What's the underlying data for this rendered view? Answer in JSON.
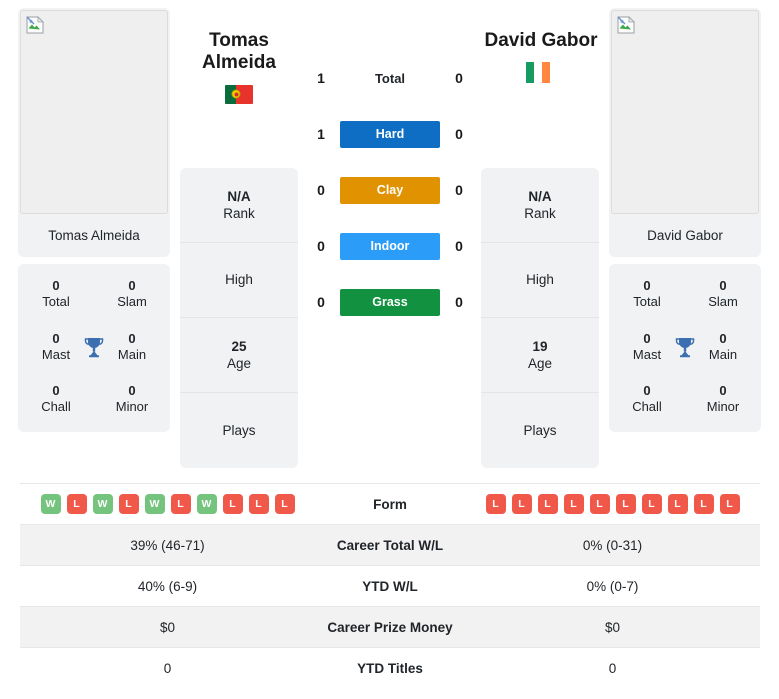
{
  "players": {
    "left": {
      "name": "Tomas Almeida",
      "display_name_line1": "Tomas",
      "display_name_line2": "Almeida",
      "country": "Portugal",
      "flag_icon": "flag-portugal-icon",
      "photo_placeholder": "broken-image-icon",
      "titles": {
        "total_value": "0",
        "total_label": "Total",
        "slam_value": "0",
        "slam_label": "Slam",
        "mast_value": "0",
        "mast_label": "Mast",
        "main_value": "0",
        "main_label": "Main",
        "chall_value": "0",
        "chall_label": "Chall",
        "minor_value": "0",
        "minor_label": "Minor",
        "trophy_icon": "trophy-icon"
      },
      "info": {
        "rank_value": "N/A",
        "rank_label": "Rank",
        "high_value": "",
        "high_label": "High",
        "age_value": "25",
        "age_label": "Age",
        "plays_value": "",
        "plays_label": "Plays"
      },
      "form": [
        "W",
        "L",
        "W",
        "L",
        "W",
        "L",
        "W",
        "L",
        "L",
        "L"
      ],
      "career_total_wl": "39% (46-71)",
      "ytd_wl": "40% (6-9)",
      "career_prize_money": "$0",
      "ytd_titles": "0"
    },
    "right": {
      "name": "David Gabor",
      "display_name_line1": "David Gabor",
      "display_name_line2": "",
      "country": "Ireland",
      "flag_icon": "flag-ireland-icon",
      "photo_placeholder": "broken-image-icon",
      "titles": {
        "total_value": "0",
        "total_label": "Total",
        "slam_value": "0",
        "slam_label": "Slam",
        "mast_value": "0",
        "mast_label": "Mast",
        "main_value": "0",
        "main_label": "Main",
        "chall_value": "0",
        "chall_label": "Chall",
        "minor_value": "0",
        "minor_label": "Minor",
        "trophy_icon": "trophy-icon"
      },
      "info": {
        "rank_value": "N/A",
        "rank_label": "Rank",
        "high_value": "",
        "high_label": "High",
        "age_value": "19",
        "age_label": "Age",
        "plays_value": "",
        "plays_label": "Plays"
      },
      "form": [
        "L",
        "L",
        "L",
        "L",
        "L",
        "L",
        "L",
        "L",
        "L",
        "L"
      ],
      "career_total_wl": "0% (0-31)",
      "ytd_wl": "0% (0-7)",
      "career_prize_money": "$0",
      "ytd_titles": "0"
    }
  },
  "head_to_head": {
    "rows": [
      {
        "left": "1",
        "label": "Total",
        "right": "0",
        "color": "",
        "style": "none"
      },
      {
        "left": "1",
        "label": "Hard",
        "right": "0",
        "color": "#0d6ec4",
        "style": "bar"
      },
      {
        "left": "0",
        "label": "Clay",
        "right": "0",
        "color": "#e09200",
        "style": "bar"
      },
      {
        "left": "0",
        "label": "Indoor",
        "right": "0",
        "color": "#2b9cf7",
        "style": "bar"
      },
      {
        "left": "0",
        "label": "Grass",
        "right": "0",
        "color": "#129141",
        "style": "bar"
      }
    ]
  },
  "stats_table": {
    "rows": [
      {
        "key": "form",
        "label": "Form",
        "type": "form"
      },
      {
        "key": "career_wl",
        "label": "Career Total W/L",
        "type": "text",
        "left": "39% (46-71)",
        "right": "0% (0-31)"
      },
      {
        "key": "ytd_wl",
        "label": "YTD W/L",
        "type": "text",
        "left": "40% (6-9)",
        "right": "0% (0-7)"
      },
      {
        "key": "prize",
        "label": "Career Prize Money",
        "type": "text",
        "left": "$0",
        "right": "$0"
      },
      {
        "key": "ytd_titles",
        "label": "YTD Titles",
        "type": "text",
        "left": "0",
        "right": "0"
      }
    ]
  },
  "colors": {
    "hard": "#0d6ec4",
    "clay": "#e09200",
    "indoor": "#2b9cf7",
    "grass": "#129141",
    "win_badge": "#74c47d",
    "loss_badge": "#f0594a",
    "panel_bg": "#f1f2f3",
    "trophy": "#3b6fb0"
  }
}
